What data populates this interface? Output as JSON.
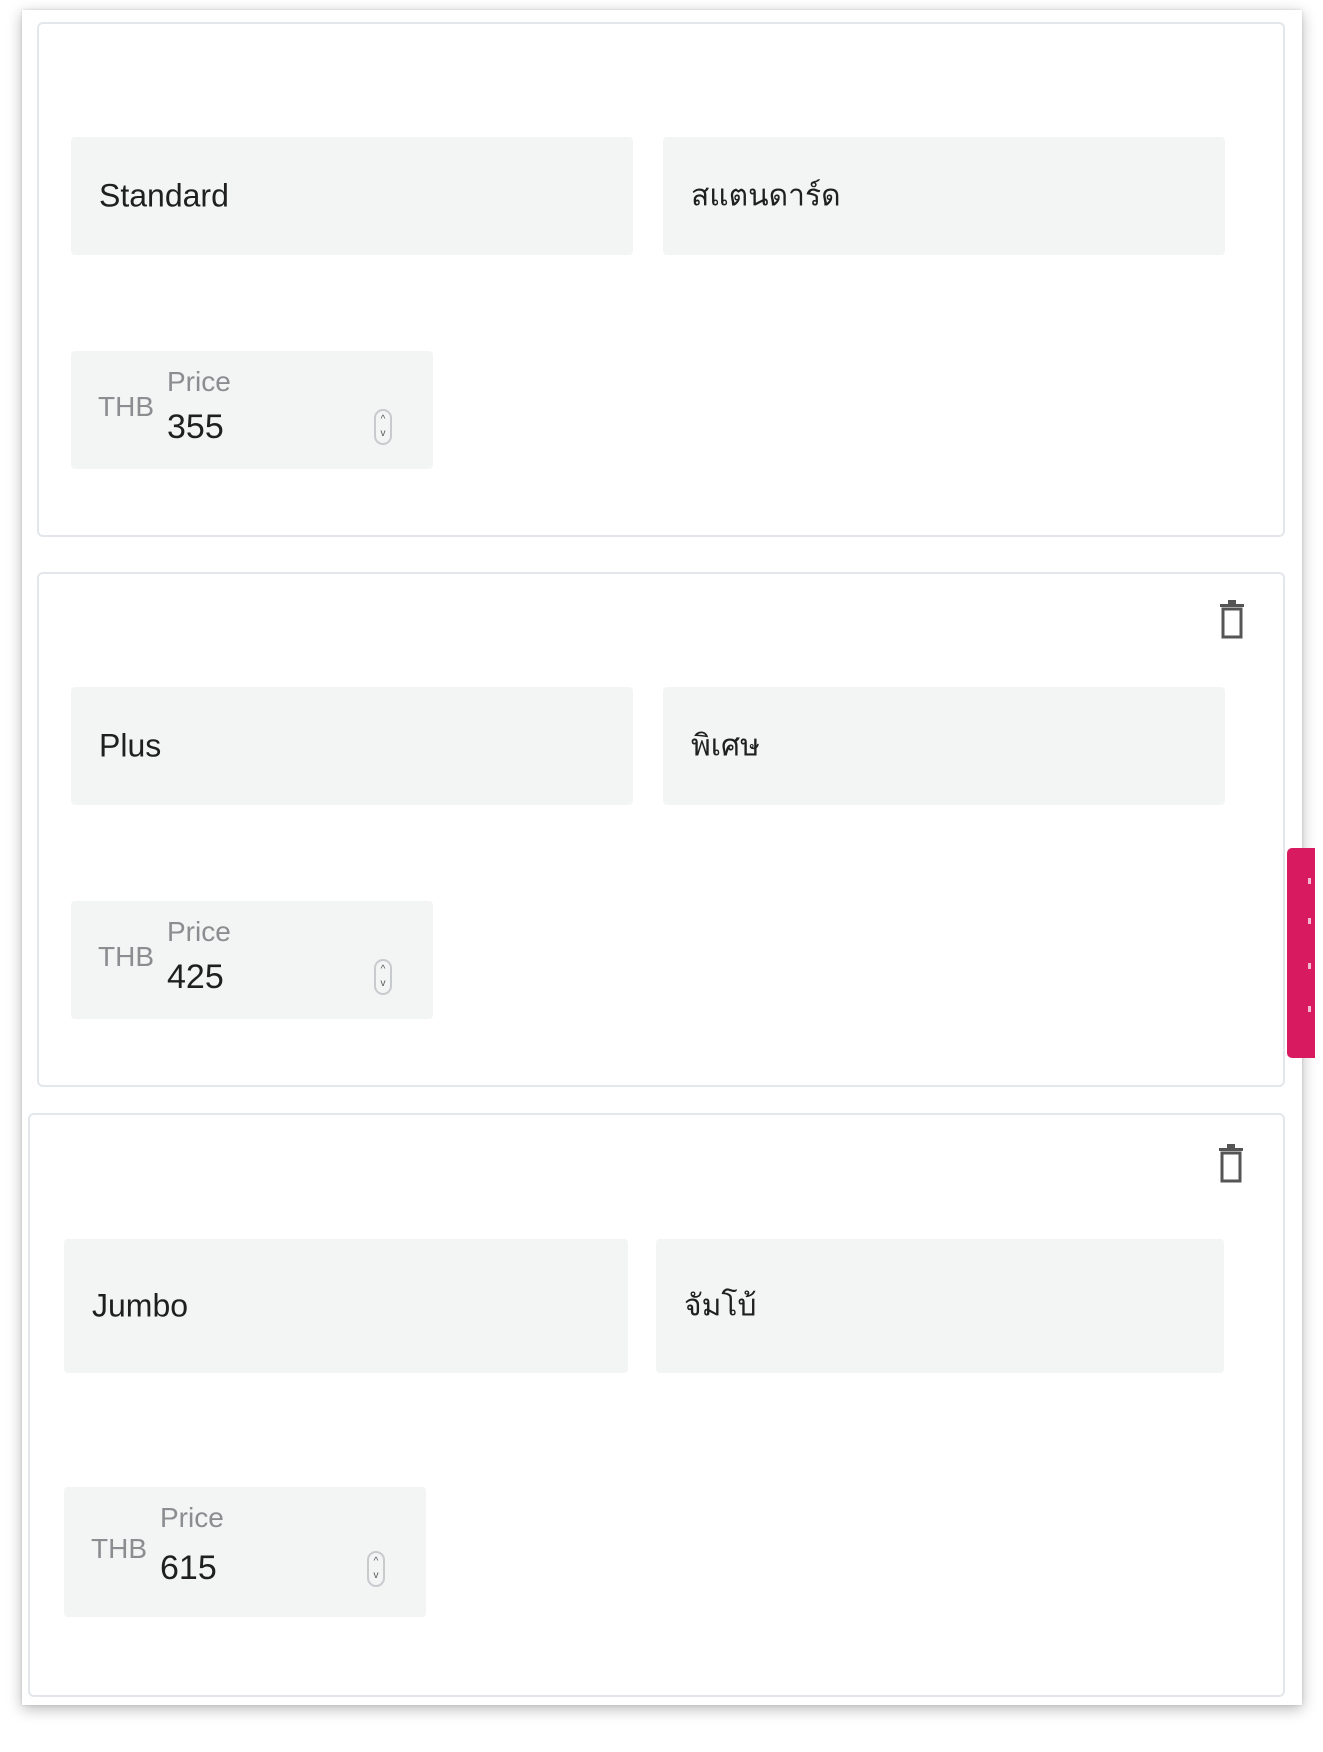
{
  "variants": [
    {
      "name_en": "Standard",
      "name_th": "สแตนดาร์ด",
      "currency": "THB",
      "price_label": "Price",
      "price": "355",
      "deletable": false
    },
    {
      "name_en": "Plus",
      "name_th": "พิเศษ",
      "currency": "THB",
      "price_label": "Price",
      "price": "425",
      "deletable": true
    },
    {
      "name_en": "Jumbo",
      "name_th": "จัมโบ้",
      "currency": "THB",
      "price_label": "Price",
      "price": "615",
      "deletable": true
    }
  ],
  "icons": {
    "delete": "trash-icon",
    "stepper": "stepper-arrows-icon"
  },
  "colors": {
    "side_tab": "#d81b60",
    "field_bg": "#f3f4f4",
    "label": "#8b8e91"
  }
}
